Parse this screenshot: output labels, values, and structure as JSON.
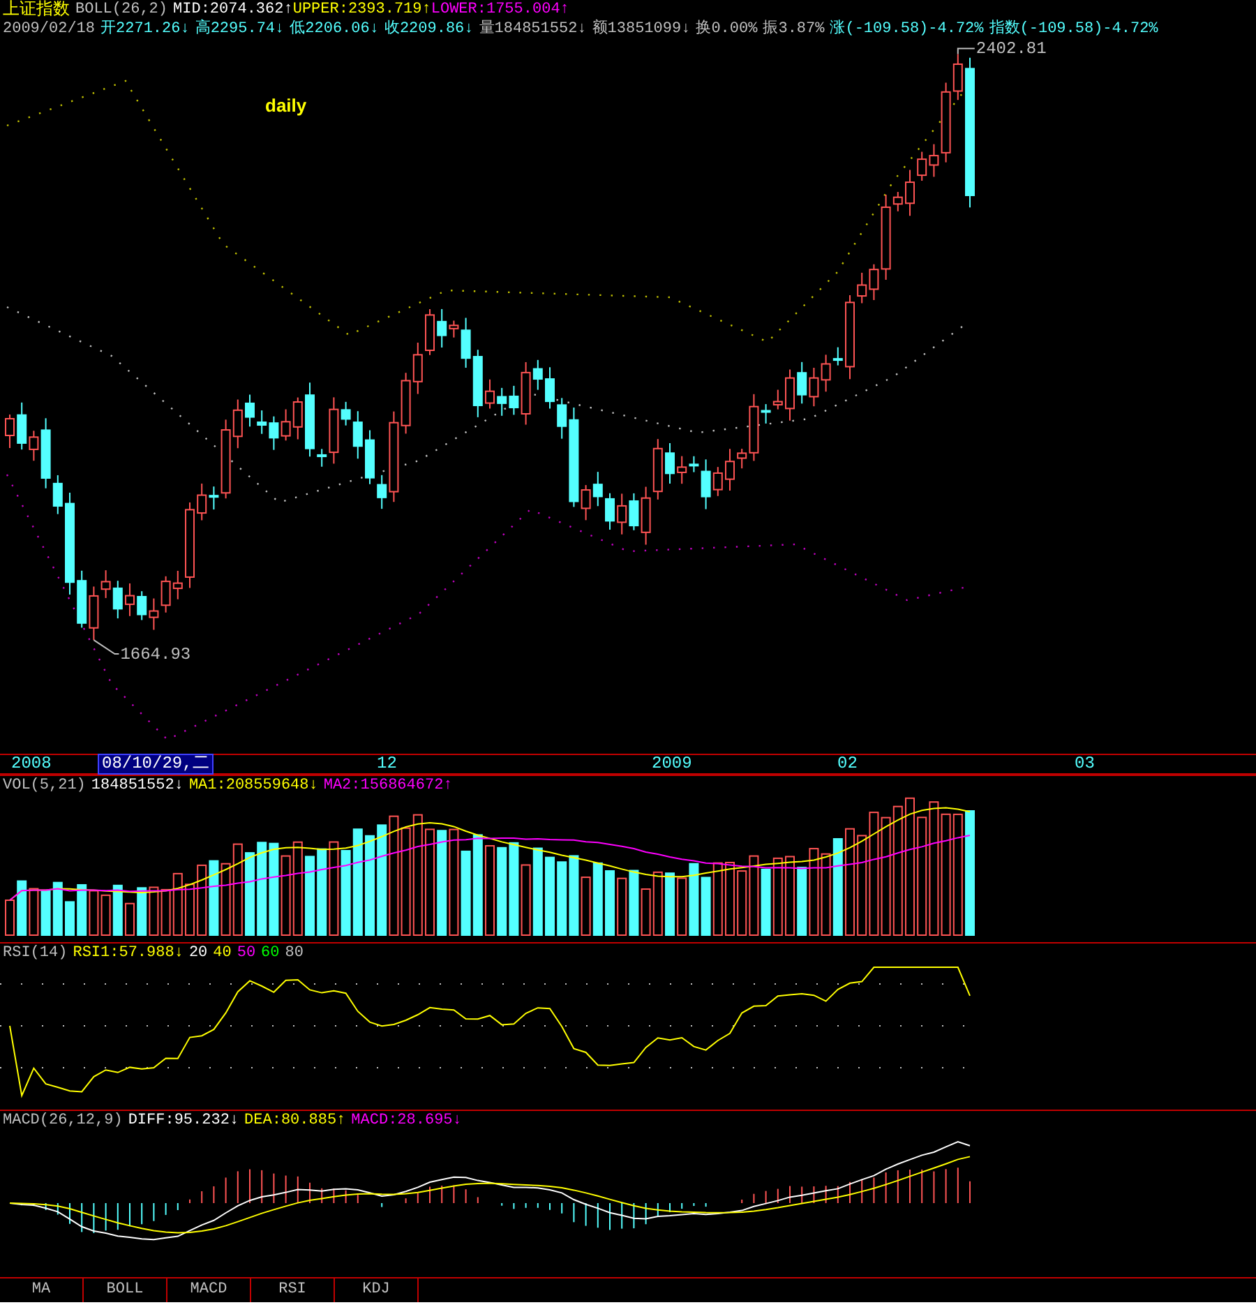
{
  "header": {
    "title": "上证指数",
    "indicator": "BOLL(26,2)",
    "bands": [
      {
        "text": "MID:2074.362↑",
        "color": "#ffffff"
      },
      {
        "text": "UPPER:2393.719↑",
        "color": "#ffff00"
      },
      {
        "text": "LOWER:1755.004↑",
        "color": "#ff00ff"
      }
    ]
  },
  "quote": {
    "date": "2009/02/18",
    "items": [
      {
        "text": "开2271.26↓",
        "color": "#54ffff"
      },
      {
        "text": "高2295.74↓",
        "color": "#54ffff"
      },
      {
        "text": "低2206.06↓",
        "color": "#54ffff"
      },
      {
        "text": "收2209.86↓",
        "color": "#54ffff"
      },
      {
        "text": "量184851552↓",
        "color": "#c0c0c0"
      },
      {
        "text": "额13851099↓",
        "color": "#c0c0c0"
      },
      {
        "text": "换0.00%",
        "color": "#c0c0c0"
      },
      {
        "text": "振3.87%",
        "color": "#c0c0c0"
      },
      {
        "text": "涨(-109.58)-4.72%",
        "color": "#54ffff"
      },
      {
        "text": "指数(-109.58)-4.72%",
        "color": "#54ffff"
      }
    ]
  },
  "main_chart": {
    "period": "daily",
    "high_label": "2402.81",
    "low_label": "1664.93"
  },
  "time_axis": [
    {
      "label": "2008",
      "selected": false
    },
    {
      "label": "08/10/29,二",
      "selected": true
    },
    {
      "label": "12",
      "selected": false
    },
    {
      "label": "2009",
      "selected": false
    },
    {
      "label": "02",
      "selected": false
    },
    {
      "label": "03",
      "selected": false
    }
  ],
  "volume": {
    "name": "VOL(5,21)",
    "items": [
      {
        "text": "184851552↓",
        "color": "#ffffff"
      },
      {
        "text": "MA1:208559648↓",
        "color": "#ffff00"
      },
      {
        "text": "MA2:156864672↑",
        "color": "#ff00ff"
      }
    ]
  },
  "rsi": {
    "name": "RSI(14)",
    "items": [
      {
        "text": "RSI1:57.988↓",
        "color": "#ffff00"
      },
      {
        "text": "20",
        "color": "#ffffff"
      },
      {
        "text": "40",
        "color": "#ffff00"
      },
      {
        "text": "50",
        "color": "#ff00ff"
      },
      {
        "text": "60",
        "color": "#00ff00"
      },
      {
        "text": "80",
        "color": "#c0c0c0"
      }
    ]
  },
  "macd": {
    "name": "MACD(26,12,9)",
    "items": [
      {
        "text": "DIFF:95.232↓",
        "color": "#ffffff"
      },
      {
        "text": "DEA:80.885↑",
        "color": "#ffff00"
      },
      {
        "text": "MACD:28.695↓",
        "color": "#ff00ff"
      }
    ]
  },
  "tabs": [
    {
      "label": "MA",
      "selected": false
    },
    {
      "label": "BOLL",
      "selected": false
    },
    {
      "label": "MACD",
      "selected": false
    },
    {
      "label": "RSI",
      "selected": false
    },
    {
      "label": "KDJ",
      "selected": false
    }
  ]
}
